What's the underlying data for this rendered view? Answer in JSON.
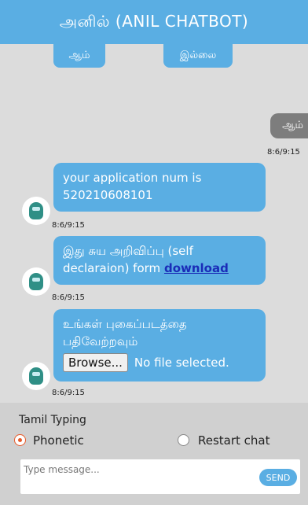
{
  "header": {
    "title": "அனில் (ANIL CHATBOT)"
  },
  "options": {
    "yes": "ஆம்",
    "no": "இல்லை"
  },
  "messages": [
    {
      "sender": "user",
      "text": "ஆம்",
      "timestamp": "8:6/9:15"
    },
    {
      "sender": "bot",
      "text": "your application num is 520210608101",
      "timestamp": "8:6/9:15"
    },
    {
      "sender": "bot",
      "text": "இது சுய அறிவிப்பு (self declaraion) form",
      "link": "download",
      "timestamp": "8:6/9:15"
    },
    {
      "sender": "bot",
      "text": "உங்கள் புகைப்படத்தை பதிவேற்றவும்",
      "browse_label": "Browse...",
      "file_status": "No file selected.",
      "timestamp": "8:6/9:15"
    }
  ],
  "bottom": {
    "tamil_typing_label": "Tamil Typing",
    "phonetic_label": "Phonetic",
    "restart_label": "Restart chat",
    "phonetic_checked": true,
    "input_placeholder": "Type message...",
    "send_label": "SEND"
  },
  "colors": {
    "accent": "#5aaee3",
    "user_bubble": "#7d7d7d",
    "link": "#1a2cb8",
    "radio_checked": "#e85a2a"
  },
  "icons": {
    "bot_avatar": "bot-avatar-icon"
  }
}
